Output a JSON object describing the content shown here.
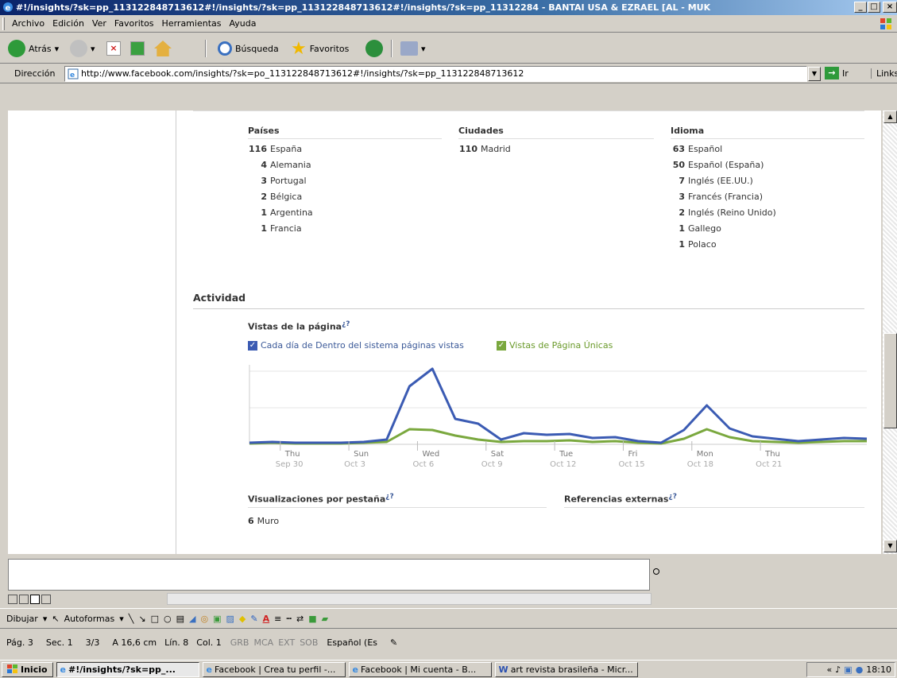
{
  "window": {
    "title": "#!/insights/?sk=pp_113122848713612#!/insights/?sk=pp_113122848713612#!/insights/?sk=pp_11312284 - BANTAI USA & EZRAEL [AL - MUK",
    "menu": [
      "Archivo",
      "Edición",
      "Ver",
      "Favoritos",
      "Herramientas",
      "Ayuda"
    ],
    "toolbar": {
      "back": "Atrás",
      "search": "Búsqueda",
      "favorites": "Favoritos"
    },
    "address_label": "Dirección",
    "address_url": "http://www.facebook.com/insights/?sk=po_113122848713612#!/insights/?sk=pp_113122848713612",
    "go_label": "Ir",
    "links_label": "Links"
  },
  "demographics": {
    "countries_header": "Países",
    "countries": [
      {
        "count": "116",
        "name": "España"
      },
      {
        "count": "4",
        "name": "Alemania"
      },
      {
        "count": "3",
        "name": "Portugal"
      },
      {
        "count": "2",
        "name": "Bélgica"
      },
      {
        "count": "1",
        "name": "Argentina"
      },
      {
        "count": "1",
        "name": "Francia"
      }
    ],
    "cities_header": "Ciudades",
    "cities": [
      {
        "count": "110",
        "name": "Madrid"
      }
    ],
    "language_header": "Idioma",
    "languages": [
      {
        "count": "63",
        "name": "Español"
      },
      {
        "count": "50",
        "name": "Español (España)"
      },
      {
        "count": "7",
        "name": "Inglés (EE.UU.)"
      },
      {
        "count": "3",
        "name": "Francés (Francia)"
      },
      {
        "count": "2",
        "name": "Inglés (Reino Unido)"
      },
      {
        "count": "1",
        "name": "Gallego"
      },
      {
        "count": "1",
        "name": "Polaco"
      }
    ]
  },
  "activity": {
    "header": "Actividad",
    "pageviews_title": "Vistas de la página",
    "help_mark": "¿?",
    "legend_1": "Cada día de Dentro del sistema páginas vistas",
    "legend_2": "Vistas de Página Únicas",
    "tab_views_title": "Visualizaciones por pestaña",
    "tab_views": [
      {
        "count": "6",
        "name": "Muro"
      }
    ],
    "external_refs_title": "Referencias externas"
  },
  "chart_data": {
    "type": "line",
    "x_ticks": [
      {
        "day": "Thu",
        "date": "Sep 30"
      },
      {
        "day": "Sun",
        "date": "Oct 3"
      },
      {
        "day": "Wed",
        "date": "Oct 6"
      },
      {
        "day": "Sat",
        "date": "Oct 9"
      },
      {
        "day": "Tue",
        "date": "Oct 12"
      },
      {
        "day": "Fri",
        "date": "Oct 15"
      },
      {
        "day": "Mon",
        "date": "Oct 18"
      },
      {
        "day": "Thu",
        "date": "Oct 21"
      }
    ],
    "x": [
      "Sep 29",
      "Sep 30",
      "Oct 1",
      "Oct 2",
      "Oct 3",
      "Oct 4",
      "Oct 5",
      "Oct 6",
      "Oct 7",
      "Oct 8",
      "Oct 9",
      "Oct 10",
      "Oct 11",
      "Oct 12",
      "Oct 13",
      "Oct 14",
      "Oct 15",
      "Oct 16",
      "Oct 17",
      "Oct 18",
      "Oct 19",
      "Oct 20",
      "Oct 21",
      "Oct 22",
      "Oct 23",
      "Oct 24"
    ],
    "ylim": [
      0,
      100
    ],
    "series": [
      {
        "name": "Cada día de Dentro del sistema páginas vistas",
        "color": "#3b5bb3",
        "values": [
          2,
          3,
          2,
          2,
          2,
          3,
          6,
          73,
          95,
          32,
          26,
          6,
          14,
          12,
          13,
          8,
          9,
          4,
          2,
          18,
          49,
          20,
          10,
          7,
          4,
          6,
          8,
          7
        ]
      },
      {
        "name": "Vistas de Página Únicas",
        "color": "#7aa83e",
        "values": [
          1,
          2,
          1,
          1,
          1,
          2,
          3,
          19,
          18,
          11,
          6,
          3,
          4,
          4,
          5,
          3,
          4,
          2,
          1,
          7,
          19,
          9,
          4,
          3,
          2,
          3,
          4,
          4
        ]
      }
    ],
    "grid": true
  },
  "word": {
    "draw_label": "Dibujar",
    "autoshapes_label": "Autoformas",
    "status": [
      "Pág. 3",
      "Sec. 1",
      "3/3",
      "A 16,6 cm",
      "Lín. 8",
      "Col. 1"
    ],
    "status_dim": [
      "GRB",
      "MCA",
      "EXT",
      "SOB"
    ],
    "status_lang": "Español (Es"
  },
  "taskbar": {
    "start": "Inicio",
    "tasks": [
      "#!/insights/?sk=pp_...",
      "Facebook | Crea tu perfil -...",
      "Facebook | Mi cuenta - B...",
      "art revista brasileña - Micr..."
    ],
    "clock": "18:10"
  }
}
